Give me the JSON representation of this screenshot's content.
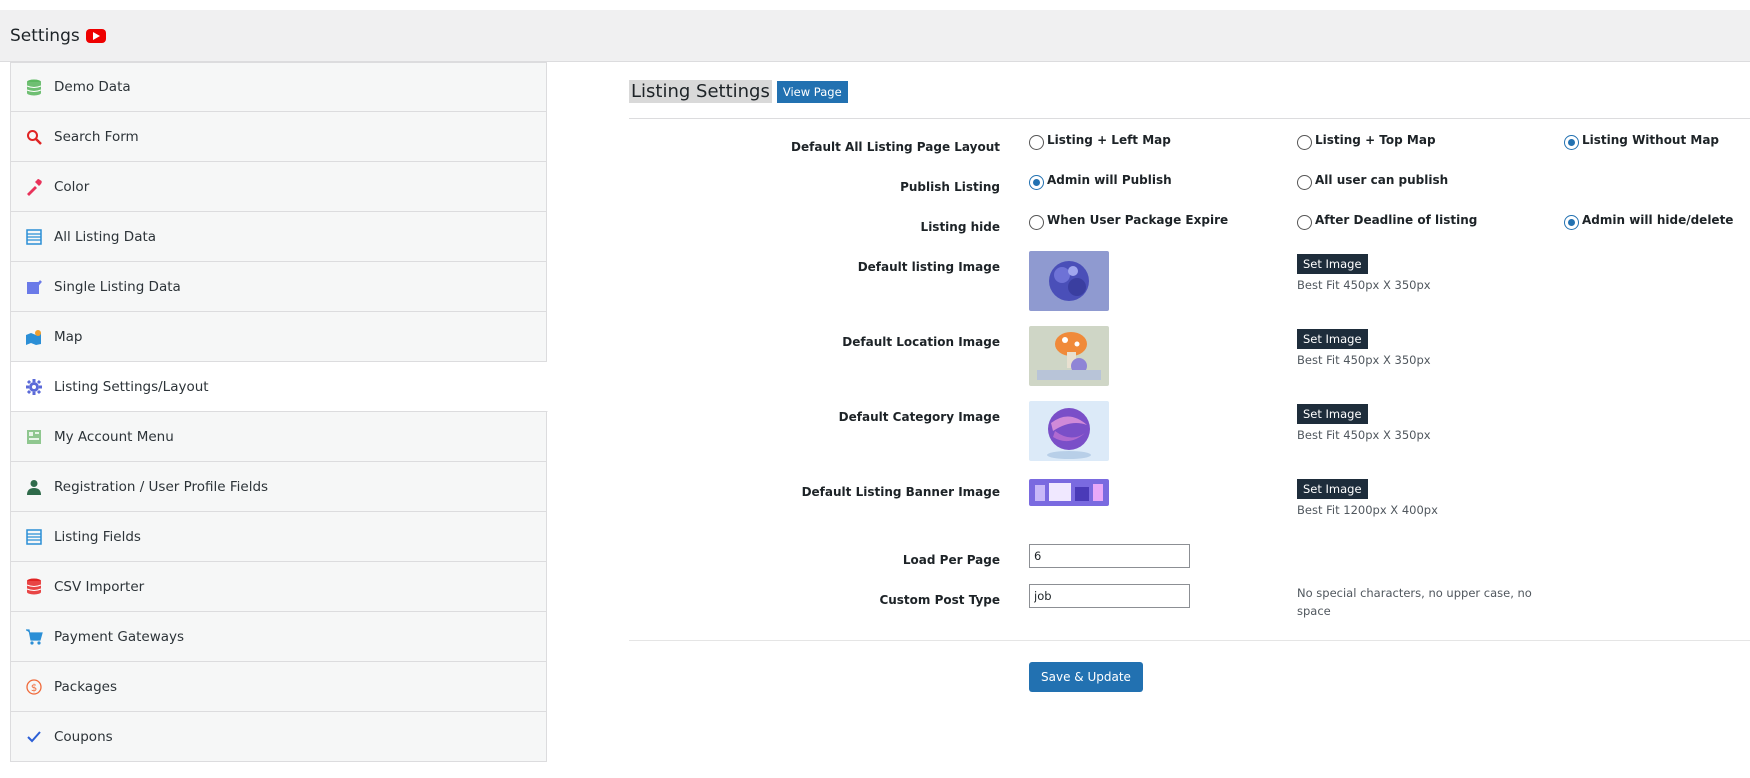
{
  "header": {
    "title": "Settings"
  },
  "sidebar": {
    "items": [
      {
        "label": "Demo Data",
        "icon": "database-icon"
      },
      {
        "label": "Search Form",
        "icon": "search-icon"
      },
      {
        "label": "Color",
        "icon": "color-picker-icon"
      },
      {
        "label": "All Listing Data",
        "icon": "list-icon"
      },
      {
        "label": "Single Listing Data",
        "icon": "edit-icon"
      },
      {
        "label": "Map",
        "icon": "map-icon"
      },
      {
        "label": "Listing Settings/Layout",
        "icon": "gear-icon"
      },
      {
        "label": "My Account Menu",
        "icon": "menu-icon"
      },
      {
        "label": "Registration / User Profile Fields",
        "icon": "user-icon"
      },
      {
        "label": "Listing Fields",
        "icon": "list-icon"
      },
      {
        "label": "CSV Importer",
        "icon": "database-icon"
      },
      {
        "label": "Payment Gateways",
        "icon": "cart-icon"
      },
      {
        "label": "Packages",
        "icon": "dollar-icon"
      },
      {
        "label": "Coupons",
        "icon": "check-icon"
      }
    ]
  },
  "main": {
    "section_title": "Listing Settings",
    "view_page_label": "View Page",
    "layout": {
      "label": "Default All Listing Page Layout",
      "options": [
        "Listing + Left Map",
        "Listing + Top Map",
        "Listing Without Map"
      ],
      "selected": "Listing Without Map"
    },
    "publish": {
      "label": "Publish Listing",
      "options": [
        "Admin will Publish",
        "All user can publish"
      ],
      "selected": "Admin will Publish"
    },
    "hide": {
      "label": "Listing hide",
      "options": [
        "When User Package Expire",
        "After Deadline of listing",
        "Admin will hide/delete"
      ],
      "selected": "Admin will hide/delete"
    },
    "images": [
      {
        "label": "Default listing Image",
        "button": "Set Image",
        "hint": "Best Fit 450px X 350px"
      },
      {
        "label": "Default Location Image",
        "button": "Set Image",
        "hint": "Best Fit 450px X 350px"
      },
      {
        "label": "Default Category Image",
        "button": "Set Image",
        "hint": "Best Fit 450px X 350px"
      },
      {
        "label": "Default Listing Banner Image",
        "button": "Set Image",
        "hint": "Best Fit 1200px X 400px"
      }
    ],
    "load_per_page": {
      "label": "Load Per Page",
      "value": "6"
    },
    "custom_post_type": {
      "label": "Custom Post Type",
      "value": "job",
      "note": "No special characters, no upper case, no space"
    },
    "save_label": "Save & Update"
  },
  "colors": {
    "accent": "#2271b1",
    "dark_button": "#1e2d3b",
    "header_bg": "#f0f0f1"
  }
}
